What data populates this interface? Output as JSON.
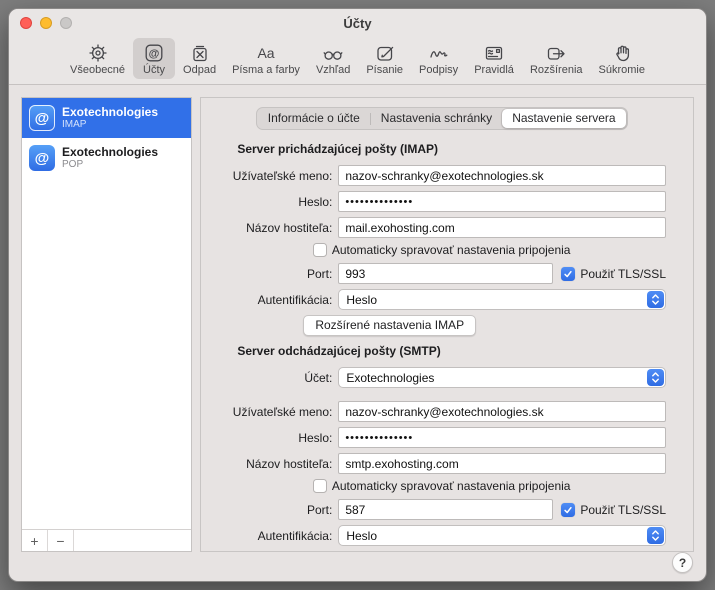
{
  "window": {
    "title": "Účty"
  },
  "colors": {
    "accent": "#2f6ce4",
    "selection": "#3170e8",
    "desktop": "#7d7d7d",
    "chrome": "#e9e6e5",
    "panel": "#e7e3e2"
  },
  "icons": {
    "at_symbol": "@",
    "fonts_sample": "Aa"
  },
  "toolbar": {
    "items": [
      {
        "label": "Všeobecné"
      },
      {
        "label": "Účty"
      },
      {
        "label": "Odpad"
      },
      {
        "label": "Písma a farby"
      },
      {
        "label": "Vzhľad"
      },
      {
        "label": "Písanie"
      },
      {
        "label": "Podpisy"
      },
      {
        "label": "Pravidlá"
      },
      {
        "label": "Rozšírenia"
      },
      {
        "label": "Súkromie"
      }
    ]
  },
  "sidebar": {
    "accounts": [
      {
        "name": "Exotechnologies",
        "protocol": "IMAP"
      },
      {
        "name": "Exotechnologies",
        "protocol": "POP"
      }
    ],
    "add": "+",
    "remove": "−"
  },
  "tabs": {
    "account_info": "Informácie o účte",
    "mailbox_settings": "Nastavenia schránky",
    "server_settings": "Nastavenie servera"
  },
  "incoming": {
    "title": "Server prichádzajúcej pošty (IMAP)",
    "username_label": "Užívateľské meno:",
    "username_value": "nazov-schranky@exotechnologies.sk",
    "password_label": "Heslo:",
    "password_value": "••••••••••••••",
    "host_label": "Názov hostiteľa:",
    "host_value": "mail.exohosting.com",
    "auto_manage_label": "Automaticky spravovať nastavenia pripojenia",
    "port_label": "Port:",
    "port_value": "993",
    "tls_label": "Použiť TLS/SSL",
    "auth_label": "Autentifikácia:",
    "auth_value": "Heslo",
    "advanced_button": "Rozšírené nastavenia IMAP"
  },
  "outgoing": {
    "title": "Server odchádzajúcej pošty (SMTP)",
    "account_label": "Účet:",
    "account_value": "Exotechnologies",
    "username_label": "Užívateľské meno:",
    "username_value": "nazov-schranky@exotechnologies.sk",
    "password_label": "Heslo:",
    "password_value": "••••••••••••••",
    "host_label": "Názov hostiteľa:",
    "host_value": "smtp.exohosting.com",
    "auto_manage_label": "Automaticky spravovať nastavenia pripojenia",
    "port_label": "Port:",
    "port_value": "587",
    "tls_label": "Použiť TLS/SSL",
    "auth_label": "Autentifikácia:",
    "auth_value": "Heslo"
  },
  "help": "?"
}
